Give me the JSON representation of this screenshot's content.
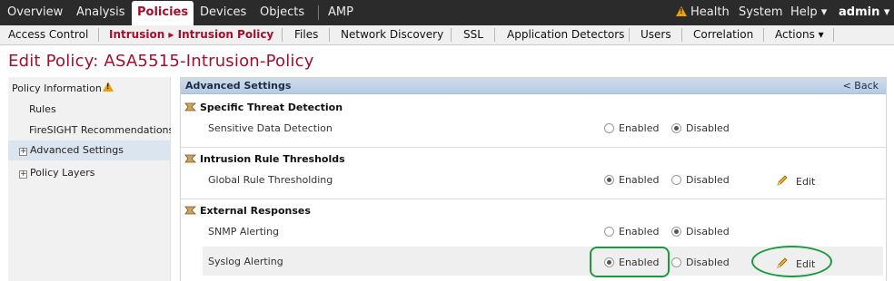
{
  "top_nav": {
    "items": [
      "Overview",
      "Analysis",
      "Policies",
      "Devices",
      "Objects",
      "AMP"
    ],
    "active": "Policies",
    "right": {
      "health": "Health",
      "system": "System",
      "help": "Help ▾",
      "user": "admin ▾"
    }
  },
  "sub_nav": {
    "items": [
      "Access Control",
      "Intrusion ▸ Intrusion Policy",
      "Files",
      "Network Discovery",
      "SSL",
      "Application Detectors",
      "Users",
      "Correlation",
      "Actions ▾"
    ],
    "active": "Intrusion ▸ Intrusion Policy"
  },
  "page_title": "Edit Policy: ASA5515-Intrusion-Policy",
  "left_panel": {
    "items": [
      {
        "label": "Policy Information",
        "warning": true
      },
      {
        "label": "Rules"
      },
      {
        "label": "FireSIGHT Recommendations"
      },
      {
        "label": "Advanced Settings",
        "expandable": true,
        "selected": true
      },
      {
        "label": "Policy Layers",
        "expandable": true
      }
    ]
  },
  "main_panel": {
    "title": "Advanced Settings",
    "back_label": "< Back",
    "sections": [
      {
        "title": "Specific Threat Detection",
        "rows": [
          {
            "label": "Sensitive Data Detection",
            "enabled_label": "Enabled",
            "disabled_label": "Disabled",
            "value": "Disabled"
          }
        ]
      },
      {
        "title": "Intrusion Rule Thresholds",
        "rows": [
          {
            "label": "Global Rule Thresholding",
            "enabled_label": "Enabled",
            "disabled_label": "Disabled",
            "value": "Enabled",
            "edit_label": "Edit"
          }
        ]
      },
      {
        "title": "External Responses",
        "rows": [
          {
            "label": "SNMP Alerting",
            "enabled_label": "Enabled",
            "disabled_label": "Disabled",
            "value": "Disabled"
          },
          {
            "label": "Syslog Alerting",
            "enabled_label": "Enabled",
            "disabled_label": "Disabled",
            "value": "Enabled",
            "edit_label": "Edit"
          }
        ]
      }
    ]
  },
  "icons": {
    "warning": "warning-icon",
    "section": "section-icon",
    "edit": "pencil-icon",
    "expand": "plus-icon"
  },
  "colors": {
    "brand_red": "#a30f2d",
    "top_bar": "#2b2b2b",
    "panel_header": "#c4d4e8",
    "annotation_green": "#1a9a3d",
    "warning": "#e8a10a"
  }
}
